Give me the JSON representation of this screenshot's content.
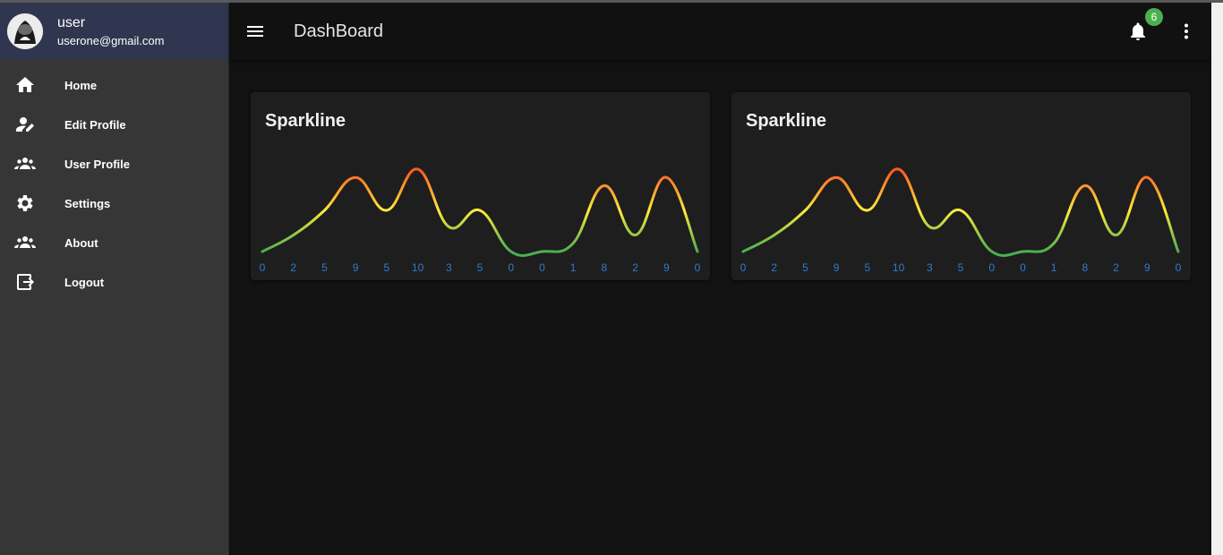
{
  "user": {
    "name": "user",
    "email": "userone@gmail.com"
  },
  "nav": [
    {
      "label": "Home",
      "icon": "home-icon"
    },
    {
      "label": "Edit Profile",
      "icon": "edit-person-icon"
    },
    {
      "label": "User Profile",
      "icon": "people-icon"
    },
    {
      "label": "Settings",
      "icon": "gear-icon"
    },
    {
      "label": "About",
      "icon": "people-icon"
    },
    {
      "label": "Logout",
      "icon": "logout-icon"
    }
  ],
  "appbar": {
    "title": "DashBoard",
    "notification_count": "6"
  },
  "cards": [
    {
      "title": "Sparkline"
    },
    {
      "title": "Sparkline"
    }
  ],
  "chart_data": [
    {
      "type": "line",
      "values": [
        0,
        2,
        5,
        9,
        5,
        10,
        3,
        5,
        0,
        0,
        1,
        8,
        2,
        9,
        0
      ],
      "x": [
        "0",
        "2",
        "5",
        "9",
        "5",
        "10",
        "3",
        "5",
        "0",
        "0",
        "1",
        "8",
        "2",
        "9",
        "0"
      ],
      "gradient": [
        "#4caf50",
        "#ffeb3b",
        "#ff5722"
      ],
      "label_color": "#2e7bcf"
    },
    {
      "type": "line",
      "values": [
        0,
        2,
        5,
        9,
        5,
        10,
        3,
        5,
        0,
        0,
        1,
        8,
        2,
        9,
        0
      ],
      "x": [
        "0",
        "2",
        "5",
        "9",
        "5",
        "10",
        "3",
        "5",
        "0",
        "0",
        "1",
        "8",
        "2",
        "9",
        "0"
      ],
      "gradient": [
        "#4caf50",
        "#ffeb3b",
        "#ff5722"
      ],
      "label_color": "#2e7bcf"
    }
  ]
}
